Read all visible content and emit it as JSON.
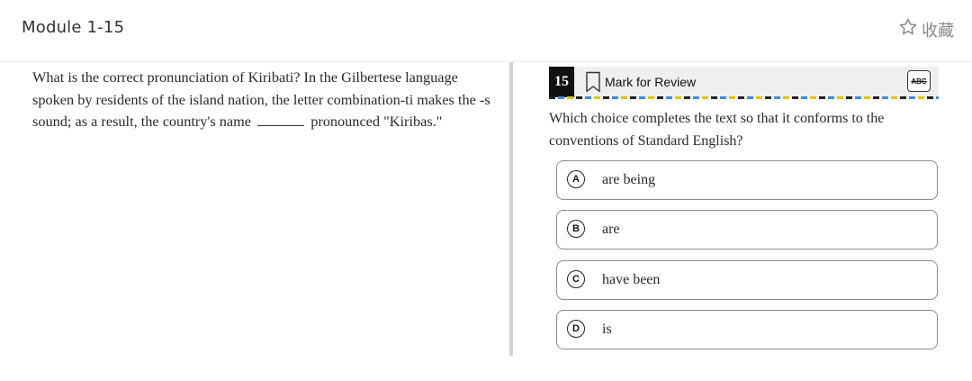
{
  "header": {
    "module_title": "Module 1-15",
    "favorite_label": "收藏",
    "favorite_icon": "star-outline-icon"
  },
  "passage": {
    "text_before_blank": "What is the correct pronunciation of Kiribati? In the Gilbertese language spoken by residents of the island nation, the letter combination-ti makes the -s sound; as a result, the country's name",
    "text_after_blank": "pronounced \"Kiribas.\""
  },
  "question": {
    "number": "15",
    "mark_for_review_label": "Mark for Review",
    "bookmark_icon": "bookmark-icon",
    "abc_tool_label": "ABC",
    "prompt": "Which choice completes the text so that it conforms to the conventions of Standard English?",
    "choices": [
      {
        "letter": "A",
        "text": "are being"
      },
      {
        "letter": "B",
        "text": "are"
      },
      {
        "letter": "C",
        "text": "have been"
      },
      {
        "letter": "D",
        "text": "is"
      }
    ]
  },
  "colors": {
    "question_number_bg": "#111111",
    "toolbar_bg": "#efefef",
    "divider": "#d2d2d2",
    "dash_blue": "#3a8dde",
    "dash_yellow": "#e6c200"
  }
}
